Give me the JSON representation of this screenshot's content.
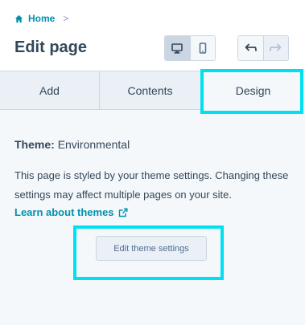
{
  "breadcrumb": {
    "home_label": "Home",
    "chevron": ">"
  },
  "header": {
    "title": "Edit page"
  },
  "device_toggle": {
    "active": "desktop"
  },
  "history": {
    "undo_enabled": true,
    "redo_enabled": false
  },
  "tabs": [
    {
      "label": "Add",
      "selected": false
    },
    {
      "label": "Contents",
      "selected": false
    },
    {
      "label": "Design",
      "selected": true
    }
  ],
  "design": {
    "theme_label": "Theme:",
    "theme_value": "Environmental",
    "description": "This page is styled by your theme settings. Changing these settings may affect multiple pages on your site.",
    "learn_link": "Learn about themes",
    "edit_button": "Edit theme settings"
  },
  "colors": {
    "accent_link": "#0091ae",
    "highlight": "#00e0f0",
    "text": "#33475b"
  }
}
